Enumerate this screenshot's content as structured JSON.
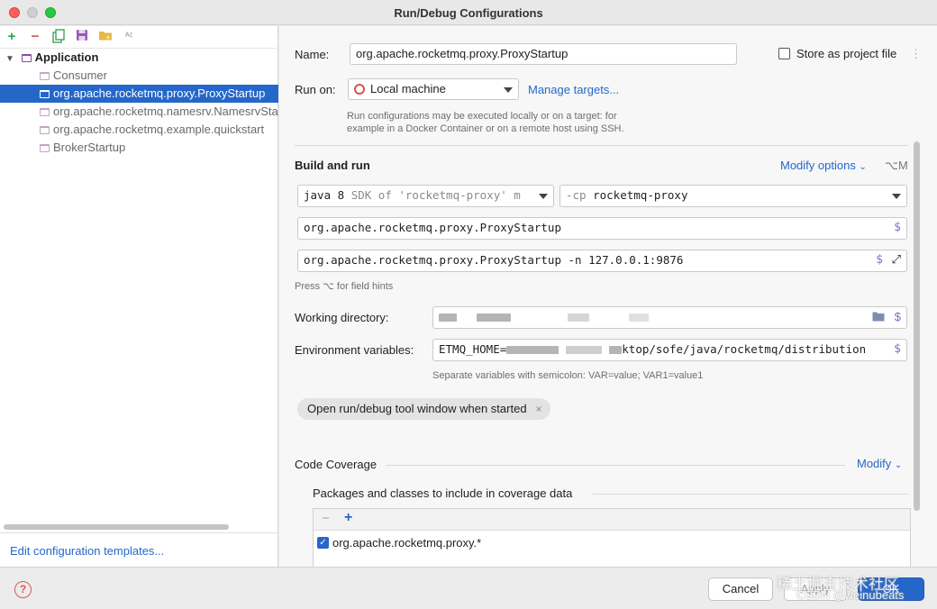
{
  "window": {
    "title": "Run/Debug Configurations",
    "traffic_lights": {
      "close": "#fe5f57",
      "minimize": "#febc2e",
      "maximize": "#28c840"
    }
  },
  "toolbar": {
    "icons": [
      "add-icon",
      "remove-icon",
      "copy-icon",
      "save-icon",
      "folder-icon",
      "sort-icon"
    ],
    "add_glyph": "+",
    "remove_glyph": "−",
    "sort_glyph": "ᴬᶻ"
  },
  "tree": {
    "root": "Application",
    "items": [
      "Consumer",
      "org.apache.rocketmq.proxy.ProxyStartup",
      "org.apache.rocketmq.namesrv.NamesrvStartup",
      "org.apache.rocketmq.example.quickstart",
      "BrokerStartup"
    ],
    "selected_index": 1
  },
  "left_footer": {
    "edit_templates": "Edit configuration templates..."
  },
  "form": {
    "name_label": "Name:",
    "name_value": "org.apache.rocketmq.proxy.ProxyStartup",
    "store_label": "Store as project file",
    "run_on_label": "Run on:",
    "run_on_value": "Local machine",
    "manage_targets": "Manage targets...",
    "run_on_hint_1": "Run configurations may be executed locally or on a target: for",
    "run_on_hint_2": "example in a Docker Container or on a remote host using SSH.",
    "build_run_title": "Build and run",
    "modify_options": "Modify options",
    "modify_shortcut": "⌥M",
    "jdk_main": "java 8",
    "jdk_sub": "SDK of 'rocketmq-proxy' m",
    "cp_flag": "-cp",
    "cp_value": "rocketmq-proxy",
    "main_class": "org.apache.rocketmq.proxy.ProxyStartup",
    "program_args": "org.apache.rocketmq.proxy.ProxyStartup -n 127.0.0.1:9876",
    "field_hints": "Press ⌥ for field hints",
    "workdir_label": "Working directory:",
    "env_label": "Environment variables:",
    "env_value_prefix": "ETMQ_HOME=",
    "env_value_suffix": "ktop/sofe/java/rocketmq/distribution",
    "env_hint": "Separate variables with semicolon: VAR=value; VAR1=value1",
    "open_tool_window": "Open run/debug tool window when started",
    "dollar": "$",
    "close_glyph": "×"
  },
  "coverage": {
    "title": "Code Coverage",
    "modify": "Modify",
    "packages_title": "Packages and classes to include in coverage data",
    "minus": "−",
    "plus": "+",
    "entries": [
      {
        "label": "org.apache.rocketmq.proxy.*",
        "checked": true
      }
    ]
  },
  "buttons": {
    "help": "?",
    "cancel": "Cancel",
    "apply": "Apply",
    "ok": "OK"
  },
  "watermark": {
    "line1": "稀土掘金技术社区",
    "line2": "CSDN @weinubeats"
  },
  "colors": {
    "accent": "#2567c9",
    "selection": "#2567c9",
    "variable_dollar": "#8b6cc7"
  }
}
